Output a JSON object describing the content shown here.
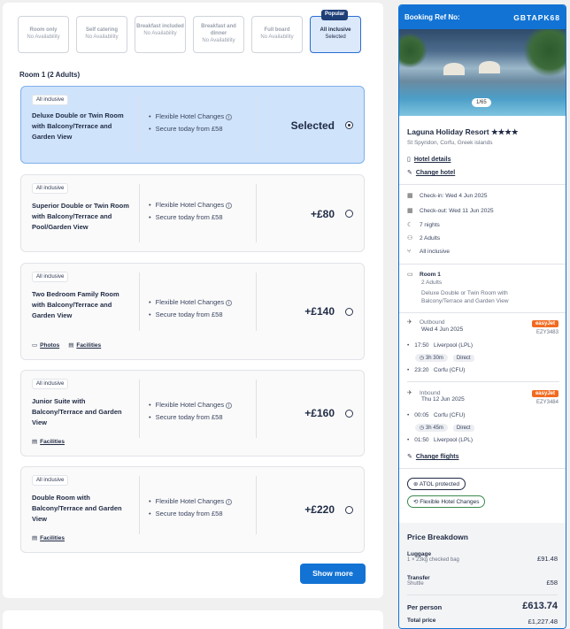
{
  "boards": [
    {
      "title": "Room only",
      "status": "No Availability"
    },
    {
      "title": "Self catering",
      "status": "No Availability"
    },
    {
      "title": "Breakfast included",
      "status": "No Availability"
    },
    {
      "title": "Breakfast and dinner",
      "status": "No Availability"
    },
    {
      "title": "Full board",
      "status": "No Availability"
    },
    {
      "title": "All inclusive",
      "status": "Selected",
      "badge": "Popular"
    }
  ],
  "room_heading": "Room 1 (2 Adults)",
  "rooms": [
    {
      "tag": "All inclusive",
      "name": "Deluxe Double or Twin Room with Balcony/Terrace and Garden View",
      "features": [
        "Flexible Hotel Changes",
        "Secure today from £58"
      ],
      "price": "Selected"
    },
    {
      "tag": "All inclusive",
      "name": "Superior Double or Twin Room with Balcony/Terrace and Pool/Garden View",
      "features": [
        "Flexible Hotel Changes",
        "Secure today from £58"
      ],
      "price": "+£80"
    },
    {
      "tag": "All inclusive",
      "name": "Two Bedroom Family Room with Balcony/Terrace and Garden View",
      "features": [
        "Flexible Hotel Changes",
        "Secure today from £58"
      ],
      "price": "+£140",
      "links": [
        "Photos",
        "Facilities"
      ]
    },
    {
      "tag": "All inclusive",
      "name": "Junior Suite with Balcony/Terrace and Garden View",
      "features": [
        "Flexible Hotel Changes",
        "Secure today from £58"
      ],
      "price": "+£160",
      "links": [
        "Facilities"
      ]
    },
    {
      "tag": "All inclusive",
      "name": "Double Room with Balcony/Terrace and Garden View",
      "features": [
        "Flexible Hotel Changes",
        "Secure today from £58"
      ],
      "price": "+£220",
      "links": [
        "Facilities"
      ]
    }
  ],
  "show_more": "Show more",
  "sidebar": {
    "ref_label": "Booking Ref No:",
    "ref": "GBTAPK68",
    "img_count": "1/65",
    "hotel_name": "Laguna Holiday Resort",
    "stars": "★★★★",
    "location": "St Spyridon, Corfu, Greek islands",
    "hotel_details": "Hotel details",
    "change_hotel": "Change hotel",
    "checkin": "Check-in: Wed 4 Jun 2025",
    "checkout": "Check-out: Wed 11 Jun 2025",
    "nights": "7 nights",
    "adults": "2 Adults",
    "board": "All inclusive",
    "room_title": "Room 1",
    "room_adults": "2 Adults",
    "room_desc": "Deluxe Double or Twin Room with Balcony/Terrace and Garden View",
    "outbound": {
      "label": "Outbound",
      "date": "Wed 4 Jun 2025",
      "airline": "easyJet",
      "code": "EZY3483",
      "dep_time": "17:50",
      "dep_place": "Liverpool (LPL)",
      "duration": "3h 30m",
      "type": "Direct",
      "arr_time": "23:20",
      "arr_place": "Corfu (CFU)"
    },
    "inbound": {
      "label": "Inbound",
      "date": "Thu 12 Jun 2025",
      "airline": "easyJet",
      "code": "EZY3484",
      "dep_time": "00:05",
      "dep_place": "Corfu (CFU)",
      "duration": "3h 45m",
      "type": "Direct",
      "arr_time": "01:50",
      "arr_place": "Liverpool (LPL)"
    },
    "change_flights": "Change flights",
    "atol": "ATOL protected",
    "flex": "Flexible Hotel Changes",
    "price_title": "Price Breakdown",
    "luggage_label": "Luggage",
    "luggage_sub": "1 × 23kg checked bag",
    "luggage_val": "£91.48",
    "transfer_label": "Transfer",
    "transfer_sub": "Shuttle",
    "transfer_val": "£58",
    "pp_label": "Per person",
    "pp_val": "£613.74",
    "total_label": "Total price",
    "total_val": "£1,227.48"
  },
  "colors": {
    "primary": "#1273d4",
    "selected_bg": "#cfe3fb",
    "easyjet": "#f26a21"
  }
}
